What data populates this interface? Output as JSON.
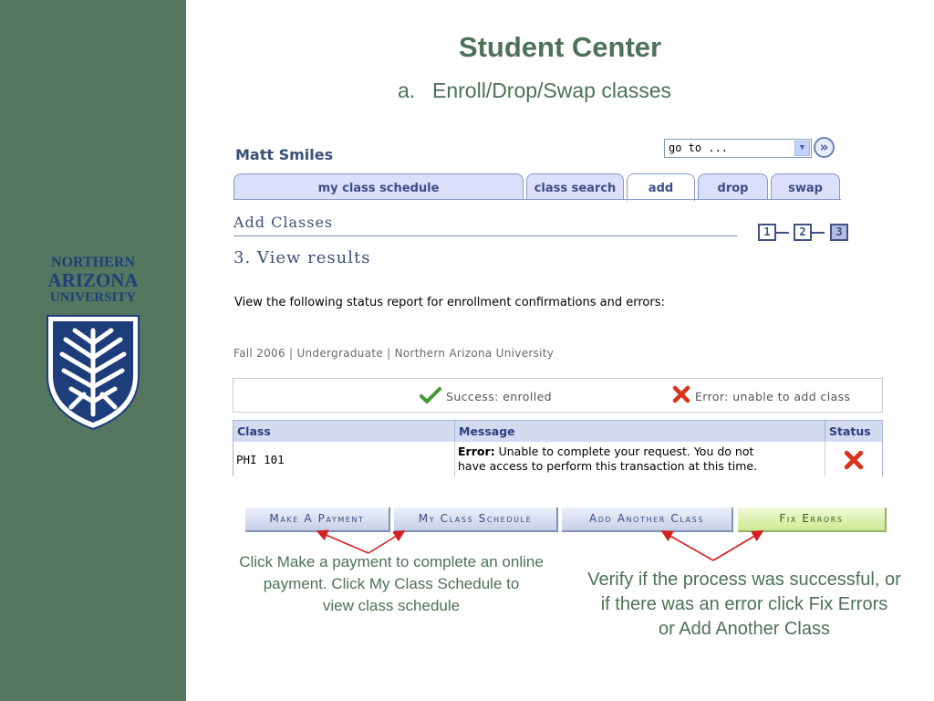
{
  "slide": {
    "title": "Student Center",
    "subtitle_marker": "a.",
    "subtitle": "Enroll/Drop/Swap classes"
  },
  "logo": {
    "line1": "NORTHERN",
    "line2": "ARIZONA",
    "line3": "UNIVERSITY"
  },
  "header": {
    "user_name": "Matt Smiles",
    "goto_value": "go to ..."
  },
  "tabs": [
    {
      "label": "my class schedule"
    },
    {
      "label": "class search"
    },
    {
      "label": "add"
    },
    {
      "label": "drop"
    },
    {
      "label": "swap"
    }
  ],
  "page": {
    "heading": "Add Classes",
    "steps": [
      "1",
      "2",
      "3"
    ],
    "current_step": "3",
    "subheading": "3. View results",
    "instruction": "View the following status report for enrollment confirmations and errors:",
    "term_line": "Fall 2006 | Undergraduate | Northern Arizona University"
  },
  "legend": {
    "success": "Success: enrolled",
    "error": "Error: unable to add class"
  },
  "results_table": {
    "headers": [
      "Class",
      "Message",
      "Status"
    ],
    "rows": [
      {
        "class": "PHI  101",
        "message_prefix": "Error:",
        "message_line1": " Unable to complete your request. You do not",
        "message_line2": "have access to perform this transaction at this time.",
        "status": "error"
      }
    ]
  },
  "actions": {
    "make_payment": "Make A Payment",
    "my_class_schedule": "My Class Schedule",
    "add_another_class": "Add Another Class",
    "fix_errors": "Fix Errors"
  },
  "callouts": {
    "left_line1": "Click Make a payment to complete an online",
    "left_line2": "payment.  Click My Class Schedule to",
    "left_line3": "view class schedule",
    "right_line1": "Verify if the process was successful, or",
    "right_line2": "if there was an error click Fix Errors",
    "right_line3": "or Add Another Class"
  },
  "colors": {
    "sidebar": "#557760",
    "title_green": "#4d7257",
    "tab_blue": "#dcdffa",
    "error_red": "#d9331c",
    "success_green": "#3e9a2c",
    "arrow_red": "#d61f1f"
  }
}
